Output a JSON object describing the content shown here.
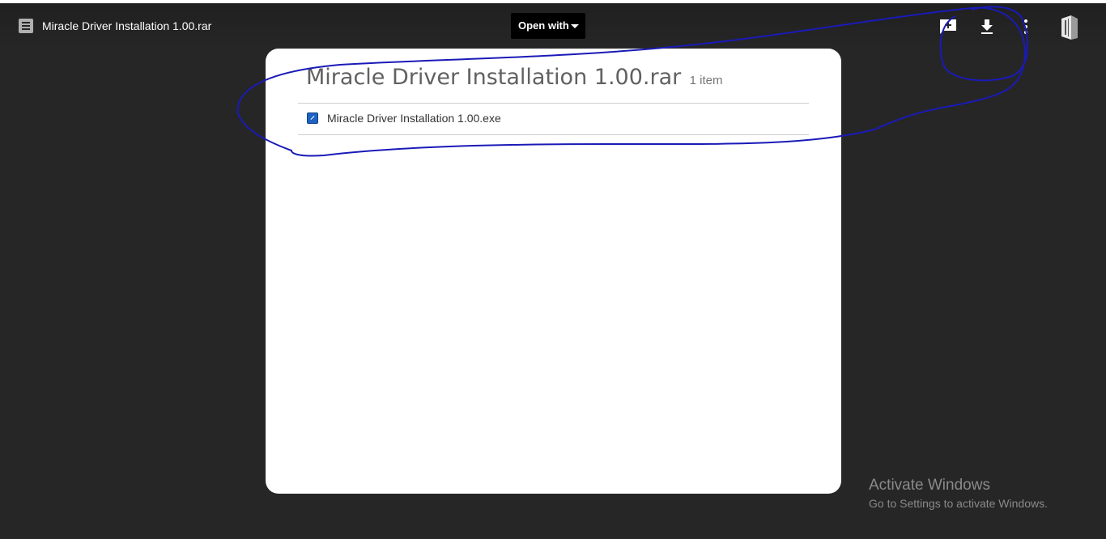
{
  "header": {
    "file_title": "Miracle Driver Installation 1.00.rar",
    "open_with_label": "Open with",
    "icons": [
      "document-icon",
      "add-comment-icon",
      "download-icon",
      "more-vert-icon",
      "archive-app-icon"
    ]
  },
  "archive": {
    "name": "Miracle Driver Installation 1.00.rar",
    "item_count": "1 item",
    "items": [
      {
        "name": "Miracle Driver Installation 1.00.exe",
        "icon": "exe-file-icon"
      }
    ]
  },
  "watermark": {
    "title": "Activate Windows",
    "subtitle": "Go to Settings to activate Windows."
  },
  "colors": {
    "background": "#262626",
    "card": "#ffffff",
    "annotation_ink": "#1a1ab8"
  }
}
